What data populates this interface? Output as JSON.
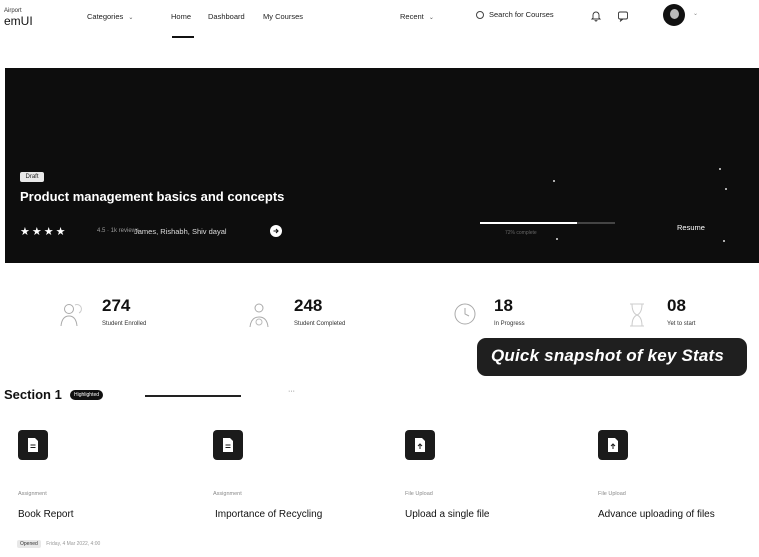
{
  "header": {
    "logo_top": "Airport",
    "logo_main": "emUI",
    "categories": {
      "label": "Categories",
      "icon": "chevron-down-icon"
    },
    "nav": [
      "Home",
      "Dashboard",
      "My Courses"
    ],
    "recent": {
      "label": "Recent",
      "icon": "chevron-down-icon"
    },
    "search_label": "Search for Courses",
    "icons": [
      "bell-icon",
      "message-icon"
    ],
    "avatar_icon": "avatar"
  },
  "hero": {
    "badge": "Draft",
    "title": "Product management basics and concepts",
    "rating": 4,
    "stars": "★★★★",
    "meta": "4.5 · 1k reviews",
    "authors": "James, Rishabh, Shiv dayal",
    "progress": 0.72,
    "progress_label": "72% complete",
    "resume_label": "Resume"
  },
  "stats": [
    {
      "value": "274",
      "label": "Student Enrolled",
      "icon": "users-icon"
    },
    {
      "value": "248",
      "label": "Student Completed",
      "icon": "graduation-icon"
    },
    {
      "value": "18",
      "label": "In Progress",
      "icon": "clock-icon"
    },
    {
      "value": "08",
      "label": "Yet to start",
      "icon": "hourglass-icon"
    }
  ],
  "callout": "Quick snapshot of key  Stats",
  "section": {
    "title": "Section 1",
    "badge": "Highlighted",
    "dots": "···"
  },
  "cards": [
    {
      "type": "Assignment",
      "title": "Book Report",
      "icon": "file-icon"
    },
    {
      "type": "Assignment",
      "title": "Importance of Recycling",
      "icon": "file-icon"
    },
    {
      "type": "File Upload",
      "title": "Upload a single file",
      "icon": "file-icon"
    },
    {
      "type": "File Upload",
      "title": "Advance uploading of files",
      "icon": "file-icon"
    }
  ],
  "footer": {
    "badge": "Opened",
    "text": "Friday, 4 Mar 2022, 4:00"
  },
  "colors": {
    "hero_bg": "#0d0d0d",
    "callout_bg": "#1f1f1f",
    "accent": "#111111"
  }
}
